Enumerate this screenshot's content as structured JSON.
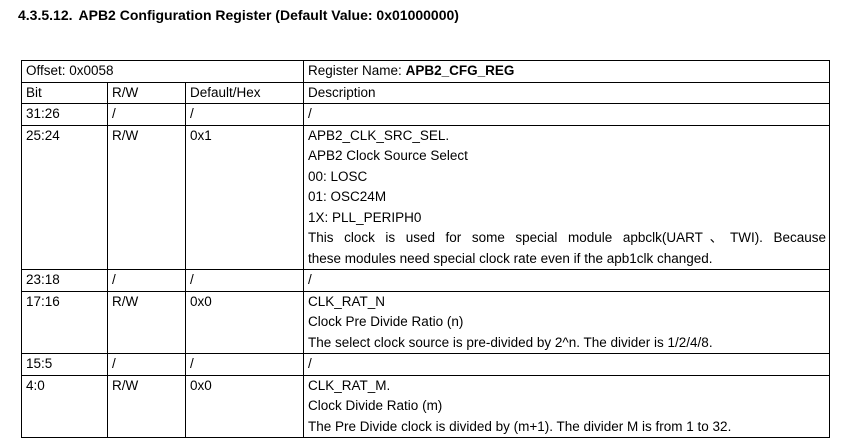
{
  "section": {
    "number": "4.3.5.12.",
    "title": "APB2 Configuration Register (Default Value: 0x01000000)"
  },
  "register": {
    "offset": "Offset: 0x0058",
    "name_label": "Register Name: ",
    "name_value": "APB2_CFG_REG"
  },
  "columns": {
    "bit": "Bit",
    "rw": "R/W",
    "default": "Default/Hex",
    "description": "Description"
  },
  "rows": [
    {
      "bit": "31:26",
      "rw": "/",
      "default": "/",
      "desc": [
        "/"
      ]
    },
    {
      "bit": "25:24",
      "rw": "R/W",
      "default": "0x1",
      "desc": [
        "APB2_CLK_SRC_SEL.",
        "APB2 Clock Source Select",
        "00: LOSC",
        "01: OSC24M",
        "1X: PLL_PERIPH0",
        "This clock is used for some special module apbclk(UART、TWI). Because",
        "these modules need special clock rate even if the apb1clk changed."
      ]
    },
    {
      "bit": "23:18",
      "rw": "/",
      "default": "/",
      "desc": [
        "/"
      ]
    },
    {
      "bit": "17:16",
      "rw": "R/W",
      "default": "0x0",
      "desc": [
        "CLK_RAT_N",
        "Clock Pre Divide Ratio (n)",
        "The select clock source is pre-divided by 2^n. The divider is 1/2/4/8."
      ]
    },
    {
      "bit": "15:5",
      "rw": "/",
      "default": "/",
      "desc": [
        "/"
      ]
    },
    {
      "bit": "4:0",
      "rw": "R/W",
      "default": "0x0",
      "desc": [
        "CLK_RAT_M.",
        "Clock Divide Ratio (m)",
        "The Pre Divide clock is divided by (m+1). The divider M is from 1 to 32."
      ]
    }
  ]
}
